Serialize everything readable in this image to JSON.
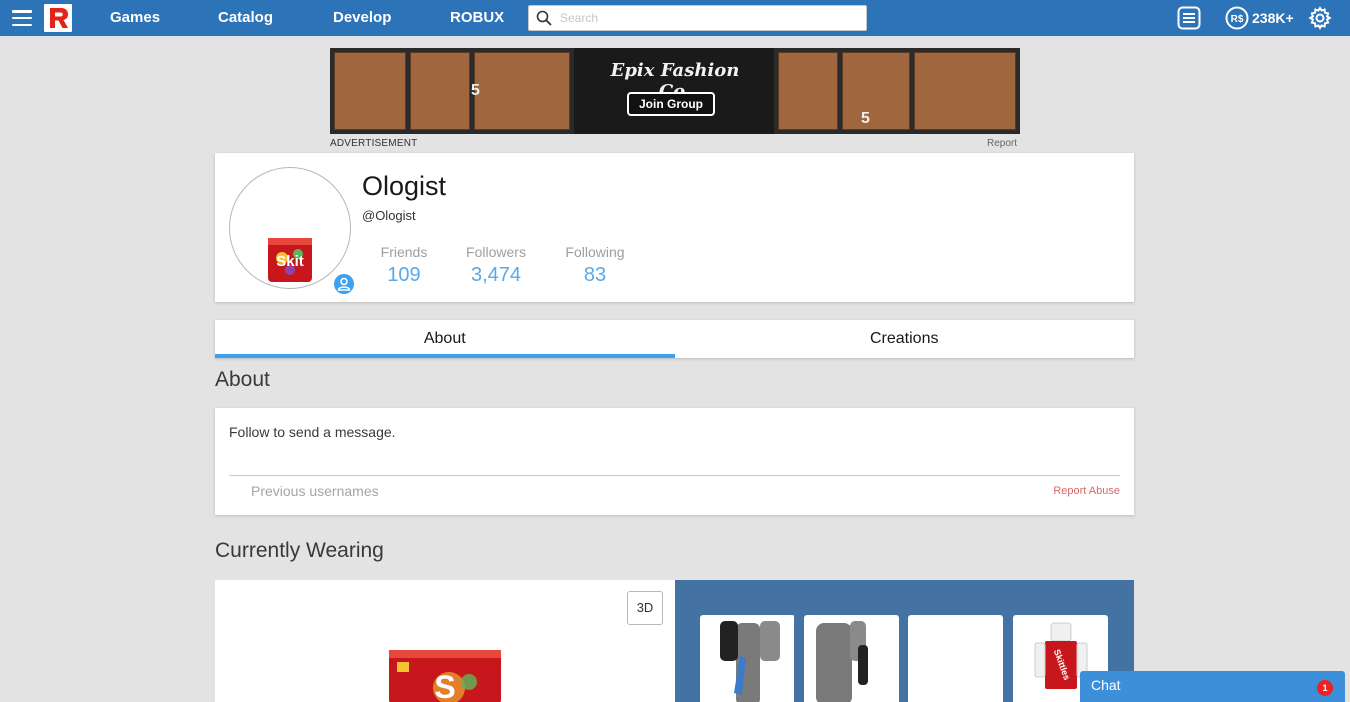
{
  "nav": {
    "links": [
      "Games",
      "Catalog",
      "Develop",
      "ROBUX"
    ],
    "search_placeholder": "Search",
    "robux_balance": "238K+",
    "brand_color": "#2d73b8"
  },
  "ad": {
    "title": "Epix Fashion Co.",
    "join_button": "Join Group",
    "price_tag": "5",
    "label": "ADVERTISEMENT",
    "report": "Report"
  },
  "profile": {
    "display_name": "Ologist",
    "username": "@Ologist",
    "stats": [
      {
        "label": "Friends",
        "value": "109"
      },
      {
        "label": "Followers",
        "value": "3,474"
      },
      {
        "label": "Following",
        "value": "83"
      }
    ],
    "avatar_text": "Skit"
  },
  "tabs": [
    {
      "label": "About",
      "active": true
    },
    {
      "label": "Creations",
      "active": false
    }
  ],
  "about": {
    "heading": "About",
    "message": "Follow to send a message.",
    "previous_usernames": "Previous usernames",
    "report_abuse": "Report Abuse"
  },
  "wearing": {
    "heading": "Currently Wearing",
    "toggle_3d": "3D",
    "avatar_text": "S",
    "item_tags": [
      "Skittles"
    ]
  },
  "chat": {
    "label": "Chat",
    "unread": "1"
  }
}
